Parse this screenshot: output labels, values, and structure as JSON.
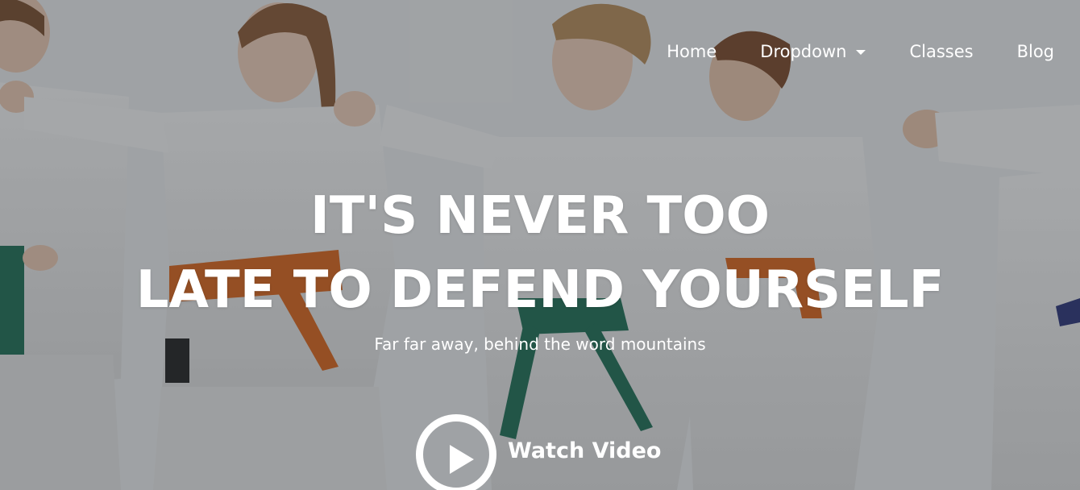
{
  "nav": {
    "items": [
      {
        "label": "Home"
      },
      {
        "label": "Dropdown",
        "has_caret": true
      },
      {
        "label": "Classes"
      },
      {
        "label": "Blog"
      }
    ]
  },
  "hero": {
    "headline_line1": "IT'S NEVER TOO",
    "headline_line2": "LATE TO DEFEND YOURSELF",
    "subtitle": "Far far away, behind the word mountains",
    "watch_label": "Watch Video",
    "icon": "play-icon"
  },
  "colors": {
    "text": "#ffffff",
    "orange_belt": "#d9651c",
    "green_belt": "#1f6e55",
    "navy_belt": "#2c3578"
  }
}
